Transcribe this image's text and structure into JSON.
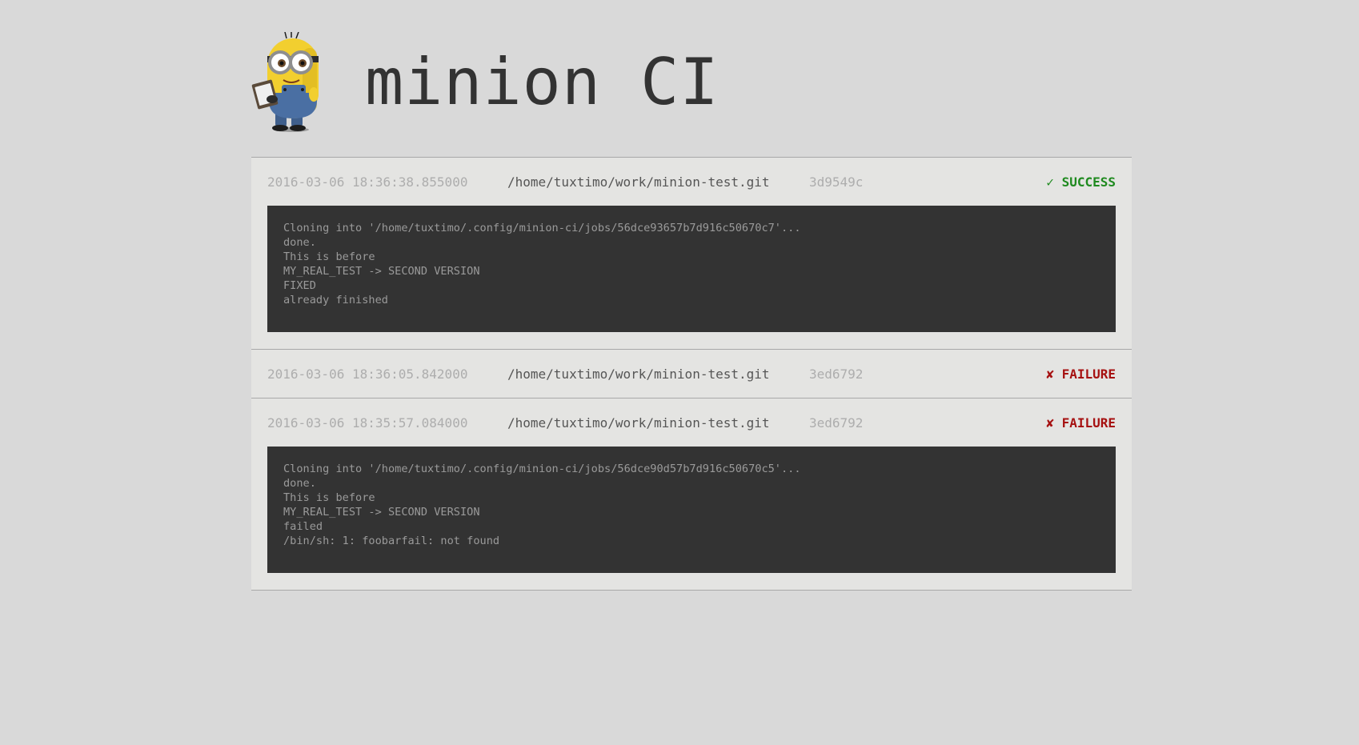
{
  "app": {
    "title": "minion CI",
    "logo_icon": "minion-logo-icon"
  },
  "colors": {
    "background": "#d9d9d9",
    "panel": "#e4e4e2",
    "log_background": "#333333",
    "success": "#1f8a1f",
    "failure": "#a61111"
  },
  "jobs": [
    {
      "date": "2016-03-06 18:36:38.855000",
      "repo": "/home/tuxtimo/work/minion-test.git",
      "commit": "3d9549c",
      "status": "✓ SUCCESS",
      "status_type": "success",
      "log": [
        "Cloning into '/home/tuxtimo/.config/minion-ci/jobs/56dce93657b7d916c50670c7'...",
        "done.",
        "This is before",
        "MY_REAL_TEST -> SECOND VERSION",
        "FIXED",
        "already finished"
      ]
    },
    {
      "date": "2016-03-06 18:36:05.842000",
      "repo": "/home/tuxtimo/work/minion-test.git",
      "commit": "3ed6792",
      "status": "✘ FAILURE",
      "status_type": "failure",
      "log": []
    },
    {
      "date": "2016-03-06 18:35:57.084000",
      "repo": "/home/tuxtimo/work/minion-test.git",
      "commit": "3ed6792",
      "status": "✘ FAILURE",
      "status_type": "failure",
      "log": [
        "Cloning into '/home/tuxtimo/.config/minion-ci/jobs/56dce90d57b7d916c50670c5'...",
        "done.",
        "This is before",
        "MY_REAL_TEST -> SECOND VERSION",
        "failed",
        "/bin/sh: 1: foobarfail: not found"
      ]
    }
  ]
}
